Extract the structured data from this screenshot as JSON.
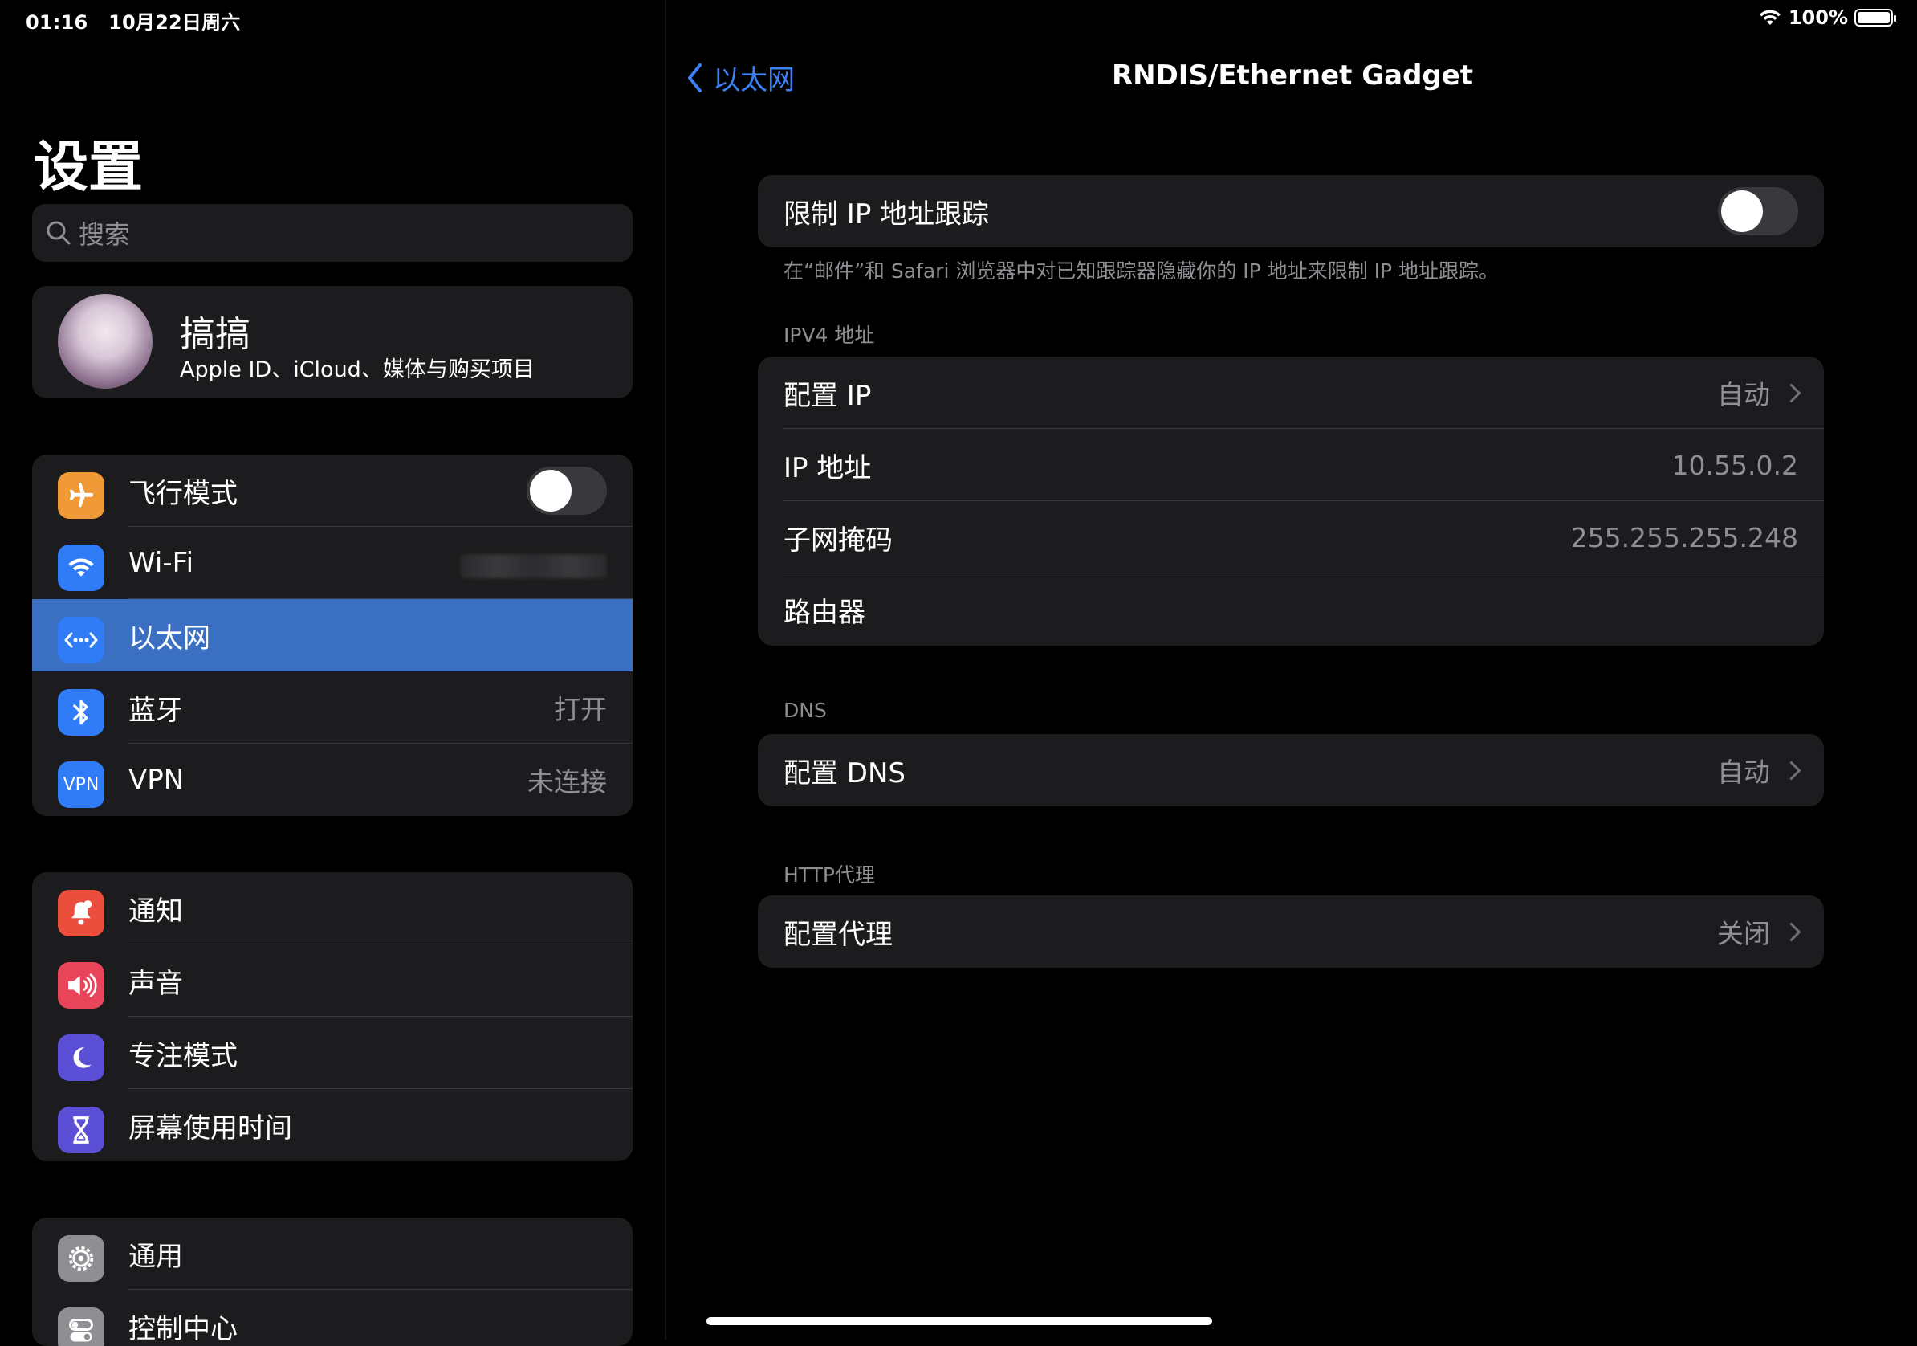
{
  "status": {
    "time": "01:16",
    "date": "10月22日周六",
    "battery": "100%"
  },
  "sidebar": {
    "title": "设置",
    "search_placeholder": "搜索",
    "profile": {
      "name": "搞搞",
      "subtitle": "Apple ID、iCloud、媒体与购买项目"
    },
    "group1": [
      {
        "label": "飞行模式",
        "icon": "airplane-icon",
        "color": "#f09a37",
        "toggle": false
      },
      {
        "label": "Wi-Fi",
        "icon": "wifi-icon",
        "color": "#2f7cf6"
      },
      {
        "label": "以太网",
        "icon": "ethernet-icon",
        "color": "#2f7cf6",
        "selected": true
      },
      {
        "label": "蓝牙",
        "icon": "bluetooth-icon",
        "color": "#2f7cf6",
        "value": "打开"
      },
      {
        "label": "VPN",
        "icon": "vpn-icon",
        "color": "#2f7cf6",
        "value": "未连接",
        "icon_text": "VPN"
      }
    ],
    "group2": [
      {
        "label": "通知",
        "icon": "bell-icon",
        "color": "#eb4e3d"
      },
      {
        "label": "声音",
        "icon": "speaker-icon",
        "color": "#e8455a"
      },
      {
        "label": "专注模式",
        "icon": "moon-icon",
        "color": "#5b4fd6"
      },
      {
        "label": "屏幕使用时间",
        "icon": "hourglass-icon",
        "color": "#5b4fd6"
      }
    ],
    "group3": [
      {
        "label": "通用",
        "icon": "gear-icon",
        "color": "#8e8e93"
      },
      {
        "label": "控制中心",
        "icon": "switches-icon",
        "color": "#8e8e93"
      }
    ]
  },
  "detail": {
    "back_label": "以太网",
    "title": "RNDIS/Ethernet Gadget",
    "limit_ip_tracking": {
      "label": "限制 IP 地址跟踪",
      "enabled": false
    },
    "limit_footer": "在“邮件”和 Safari 浏览器中对已知跟踪器隐藏你的 IP 地址来限制 IP 地址跟踪。",
    "ipv4_header": "IPV4 地址",
    "ipv4": [
      {
        "label": "配置 IP",
        "value": "自动",
        "chevron": true
      },
      {
        "label": "IP 地址",
        "value": "10.55.0.2"
      },
      {
        "label": "子网掩码",
        "value": "255.255.255.248"
      },
      {
        "label": "路由器",
        "value": ""
      }
    ],
    "dns_header": "DNS",
    "dns": {
      "label": "配置 DNS",
      "value": "自动"
    },
    "proxy_header": "HTTP代理",
    "proxy": {
      "label": "配置代理",
      "value": "关闭"
    }
  }
}
